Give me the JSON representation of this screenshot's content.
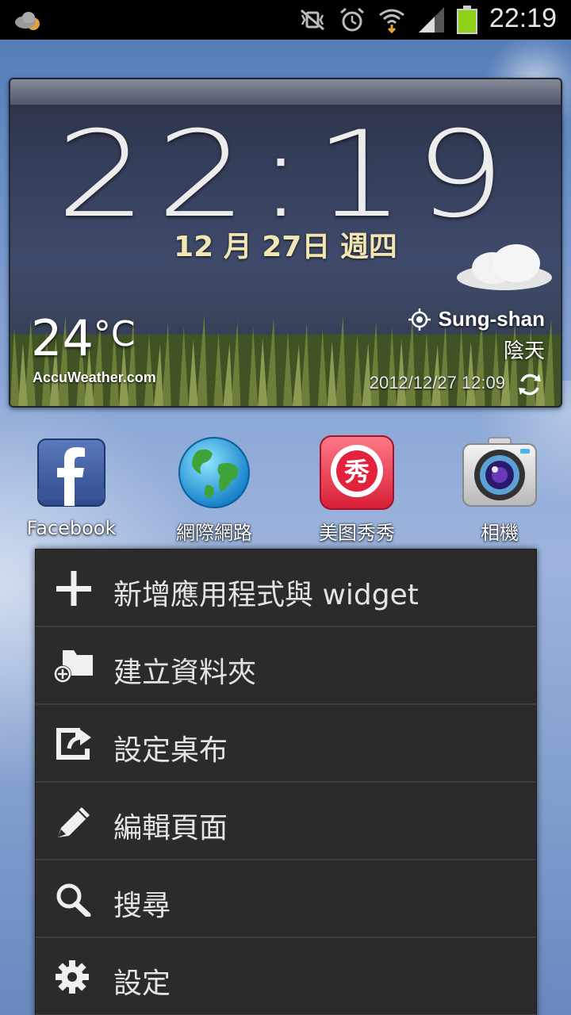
{
  "status_bar": {
    "time": "22:19",
    "icons": [
      "weather-cloud-sun-icon",
      "mute-vibrate-icon",
      "alarm-icon",
      "wifi-icon",
      "signal-icon",
      "battery-icon"
    ]
  },
  "clock_widget": {
    "time": "22:19",
    "date": "12 月 27日 週四",
    "temperature": "24",
    "temperature_unit": "°C",
    "brand": "AccuWeather.com",
    "location": "Sung-shan",
    "condition": "陰天",
    "updated": "2012/12/27 12:09"
  },
  "apps": [
    {
      "label": "Facebook",
      "icon": "facebook-icon"
    },
    {
      "label": "網際網路",
      "icon": "globe-icon"
    },
    {
      "label": "美图秀秀",
      "icon": "meitu-icon"
    },
    {
      "label": "相機",
      "icon": "camera-icon"
    }
  ],
  "menu": {
    "items": [
      {
        "label": "新增應用程式與 widget",
        "icon": "plus-icon"
      },
      {
        "label": "建立資料夾",
        "icon": "folder-add-icon"
      },
      {
        "label": "設定桌布",
        "icon": "wallpaper-icon"
      },
      {
        "label": "編輯頁面",
        "icon": "pencil-icon"
      },
      {
        "label": "搜尋",
        "icon": "search-icon"
      },
      {
        "label": "設定",
        "icon": "gear-icon"
      }
    ]
  },
  "colors": {
    "menu_bg": "#2b2b2b",
    "menu_divider": "#3d3d3d",
    "date_text": "#f2e6b4",
    "battery_green": "#8fd11a"
  }
}
